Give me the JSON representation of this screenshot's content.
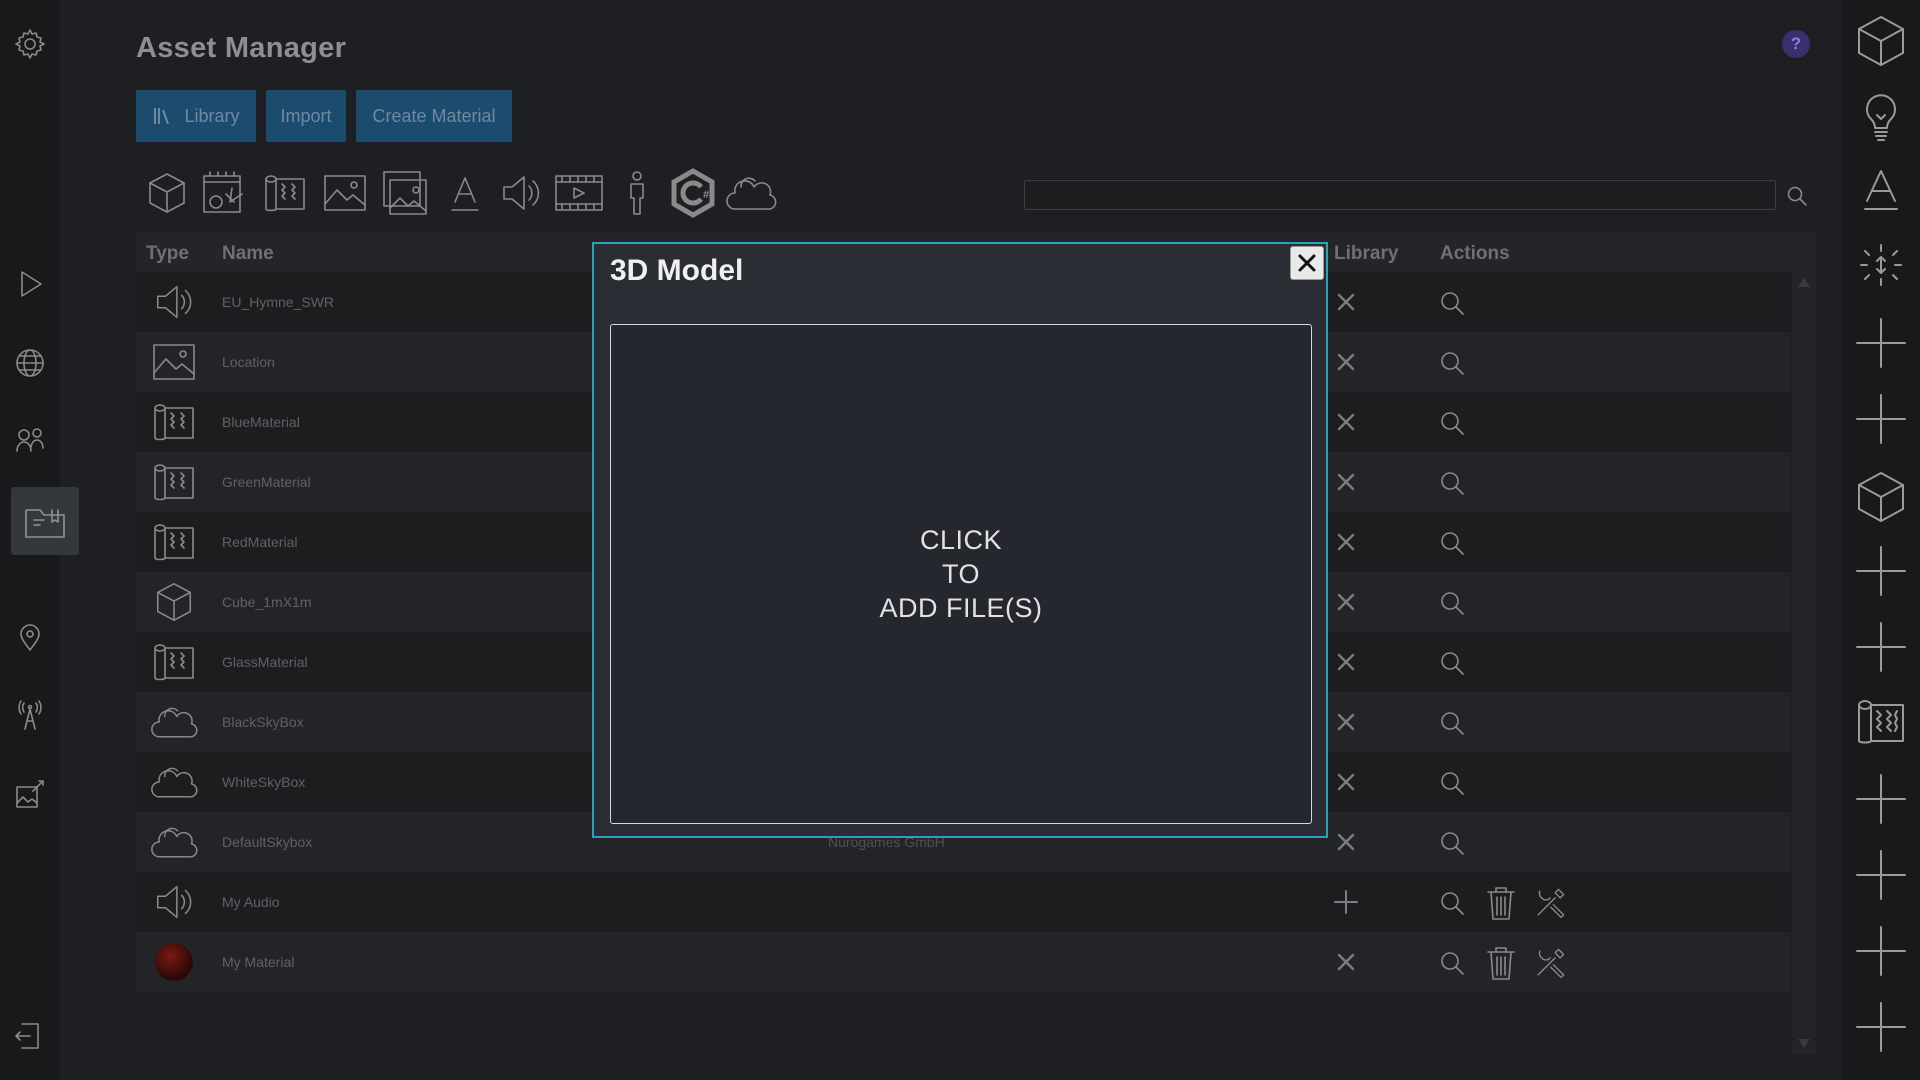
{
  "title": "Asset Manager",
  "help_label": "?",
  "tabs": [
    {
      "label": "Library",
      "icon": "library-icon"
    },
    {
      "label": "Import"
    },
    {
      "label": "Create Material"
    }
  ],
  "search": {
    "value": "",
    "placeholder": ""
  },
  "table": {
    "headers": {
      "type": "Type",
      "name": "Name",
      "library": "Library",
      "actions": "Actions"
    },
    "rows": [
      {
        "type": "audio",
        "name": "EU_Hymne_SWR",
        "vendor": "",
        "library": "remove",
        "actions": [
          "view"
        ]
      },
      {
        "type": "image",
        "name": "Location",
        "vendor": "",
        "library": "remove",
        "actions": [
          "view"
        ]
      },
      {
        "type": "material",
        "name": "BlueMaterial",
        "vendor": "",
        "library": "remove",
        "actions": [
          "view"
        ]
      },
      {
        "type": "material",
        "name": "GreenMaterial",
        "vendor": "",
        "library": "remove",
        "actions": [
          "view"
        ]
      },
      {
        "type": "material",
        "name": "RedMaterial",
        "vendor": "",
        "library": "remove",
        "actions": [
          "view"
        ]
      },
      {
        "type": "model",
        "name": "Cube_1mX1m",
        "vendor": "",
        "library": "remove",
        "actions": [
          "view"
        ]
      },
      {
        "type": "material",
        "name": "GlassMaterial",
        "vendor": "",
        "library": "remove",
        "actions": [
          "view"
        ]
      },
      {
        "type": "skybox",
        "name": "BlackSkyBox",
        "vendor": "",
        "library": "remove",
        "actions": [
          "view"
        ]
      },
      {
        "type": "skybox",
        "name": "WhiteSkyBox",
        "vendor": "",
        "library": "remove",
        "actions": [
          "view"
        ]
      },
      {
        "type": "skybox",
        "name": "DefaultSkybox",
        "vendor": "Nurogames GmbH",
        "library": "remove",
        "actions": [
          "view"
        ]
      },
      {
        "type": "audio",
        "name": "My Audio",
        "vendor": "",
        "library": "add",
        "actions": [
          "view",
          "delete",
          "edit"
        ]
      },
      {
        "type": "sphere",
        "name": "My Material",
        "vendor": "",
        "library": "remove",
        "actions": [
          "view",
          "delete",
          "edit"
        ]
      }
    ]
  },
  "modal": {
    "title": "3D Model",
    "dropzone_lines": [
      "CLICK",
      "TO",
      "ADD FILE(S)"
    ]
  },
  "colors": {
    "accent": "#2aa3b8",
    "tab_bg": "#1b4c6e",
    "help": "#3a2f6e"
  }
}
